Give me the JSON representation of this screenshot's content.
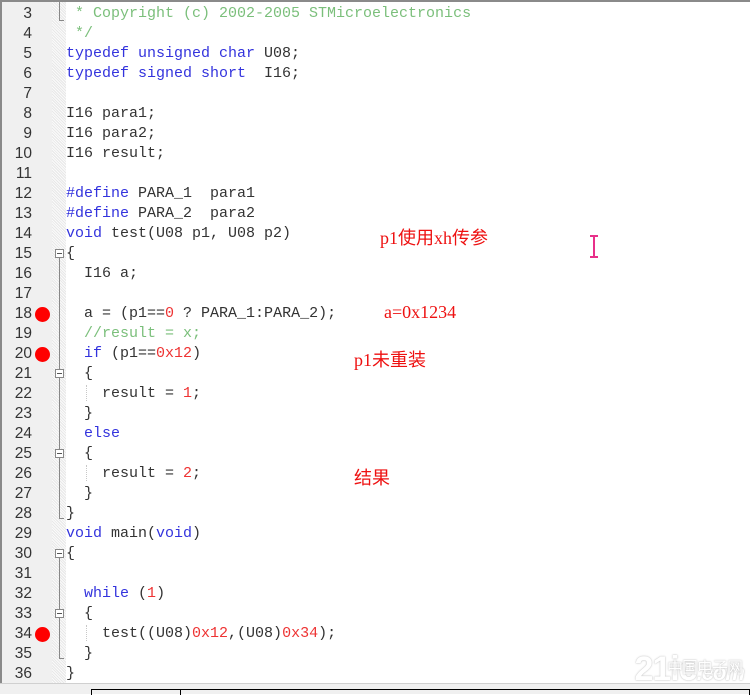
{
  "editor": {
    "lines": [
      {
        "n": "3",
        "bp": false,
        "fold": "",
        "html": [
          {
            "t": " * Copyright (c) 2002-2005 STMicroelectronics",
            "c": "cm"
          }
        ]
      },
      {
        "n": "4",
        "bp": false,
        "fold": "",
        "html": [
          {
            "t": " */",
            "c": "cm"
          }
        ]
      },
      {
        "n": "5",
        "bp": false,
        "fold": "",
        "html": [
          {
            "t": "typedef unsigned char",
            "c": "kw"
          },
          {
            "t": " U08;",
            "c": ""
          }
        ]
      },
      {
        "n": "6",
        "bp": false,
        "fold": "",
        "html": [
          {
            "t": "typedef signed short",
            "c": "kw"
          },
          {
            "t": "  I16;",
            "c": ""
          }
        ]
      },
      {
        "n": "7",
        "bp": false,
        "fold": "",
        "html": []
      },
      {
        "n": "8",
        "bp": false,
        "fold": "",
        "html": [
          {
            "t": "I16 para1;",
            "c": ""
          }
        ]
      },
      {
        "n": "9",
        "bp": false,
        "fold": "",
        "html": [
          {
            "t": "I16 para2;",
            "c": ""
          }
        ]
      },
      {
        "n": "10",
        "bp": false,
        "fold": "",
        "html": [
          {
            "t": "I16 result;",
            "c": ""
          }
        ]
      },
      {
        "n": "11",
        "bp": false,
        "fold": "",
        "html": []
      },
      {
        "n": "12",
        "bp": false,
        "fold": "",
        "html": [
          {
            "t": "#define",
            "c": "kw"
          },
          {
            "t": " PARA_1  para1",
            "c": ""
          }
        ]
      },
      {
        "n": "13",
        "bp": false,
        "fold": "",
        "html": [
          {
            "t": "#define",
            "c": "kw"
          },
          {
            "t": " PARA_2  para2",
            "c": ""
          }
        ]
      },
      {
        "n": "14",
        "bp": false,
        "fold": "",
        "html": [
          {
            "t": "void",
            "c": "kw"
          },
          {
            "t": " test(U08 p1, U08 p2)",
            "c": ""
          }
        ]
      },
      {
        "n": "15",
        "bp": false,
        "fold": "box",
        "html": [
          {
            "t": "{",
            "c": ""
          }
        ]
      },
      {
        "n": "16",
        "bp": false,
        "fold": "",
        "html": [
          {
            "t": "  I16 a;",
            "c": ""
          }
        ]
      },
      {
        "n": "17",
        "bp": false,
        "fold": "",
        "html": []
      },
      {
        "n": "18",
        "bp": true,
        "fold": "",
        "html": [
          {
            "t": "  a = (p1==",
            "c": ""
          },
          {
            "t": "0",
            "c": "nm"
          },
          {
            "t": " ? PARA_1:PARA_2);",
            "c": ""
          }
        ]
      },
      {
        "n": "19",
        "bp": false,
        "fold": "",
        "html": [
          {
            "t": "  //result = x;",
            "c": "cm"
          }
        ]
      },
      {
        "n": "20",
        "bp": true,
        "fold": "",
        "html": [
          {
            "t": "  ",
            "c": ""
          },
          {
            "t": "if",
            "c": "kw"
          },
          {
            "t": " (p1==",
            "c": ""
          },
          {
            "t": "0x12",
            "c": "nm"
          },
          {
            "t": ")",
            "c": ""
          }
        ]
      },
      {
        "n": "21",
        "bp": false,
        "fold": "box",
        "html": [
          {
            "t": "  {",
            "c": ""
          }
        ]
      },
      {
        "n": "22",
        "bp": false,
        "fold": "",
        "html": [
          {
            "t": "    result = ",
            "c": ""
          },
          {
            "t": "1",
            "c": "nm"
          },
          {
            "t": ";",
            "c": ""
          }
        ]
      },
      {
        "n": "23",
        "bp": false,
        "fold": "",
        "html": [
          {
            "t": "  }",
            "c": ""
          }
        ]
      },
      {
        "n": "24",
        "bp": false,
        "fold": "",
        "html": [
          {
            "t": "  ",
            "c": ""
          },
          {
            "t": "else",
            "c": "kw"
          }
        ]
      },
      {
        "n": "25",
        "bp": false,
        "fold": "box",
        "html": [
          {
            "t": "  {",
            "c": ""
          }
        ]
      },
      {
        "n": "26",
        "bp": false,
        "fold": "",
        "html": [
          {
            "t": "    result = ",
            "c": ""
          },
          {
            "t": "2",
            "c": "nm"
          },
          {
            "t": ";",
            "c": ""
          }
        ]
      },
      {
        "n": "27",
        "bp": false,
        "fold": "",
        "html": [
          {
            "t": "  }",
            "c": ""
          }
        ]
      },
      {
        "n": "28",
        "bp": false,
        "fold": "",
        "html": [
          {
            "t": "}",
            "c": ""
          }
        ]
      },
      {
        "n": "29",
        "bp": false,
        "fold": "",
        "html": [
          {
            "t": "void",
            "c": "kw"
          },
          {
            "t": " main(",
            "c": ""
          },
          {
            "t": "void",
            "c": "kw"
          },
          {
            "t": ")",
            "c": ""
          }
        ]
      },
      {
        "n": "30",
        "bp": false,
        "fold": "box",
        "html": [
          {
            "t": "{",
            "c": ""
          }
        ]
      },
      {
        "n": "31",
        "bp": false,
        "fold": "",
        "html": []
      },
      {
        "n": "32",
        "bp": false,
        "fold": "",
        "html": [
          {
            "t": "  ",
            "c": ""
          },
          {
            "t": "while",
            "c": "kw"
          },
          {
            "t": " (",
            "c": ""
          },
          {
            "t": "1",
            "c": "nm"
          },
          {
            "t": ")",
            "c": ""
          }
        ]
      },
      {
        "n": "33",
        "bp": false,
        "fold": "box",
        "html": [
          {
            "t": "  {",
            "c": ""
          }
        ]
      },
      {
        "n": "34",
        "bp": true,
        "fold": "",
        "html": [
          {
            "t": "    test((U08)",
            "c": ""
          },
          {
            "t": "0x12",
            "c": "nm"
          },
          {
            "t": ",(U08)",
            "c": ""
          },
          {
            "t": "0x34",
            "c": "nm"
          },
          {
            "t": ");",
            "c": ""
          }
        ]
      },
      {
        "n": "35",
        "bp": false,
        "fold": "",
        "html": [
          {
            "t": "  }",
            "c": ""
          }
        ]
      },
      {
        "n": "36",
        "bp": false,
        "fold": "",
        "html": [
          {
            "t": "}",
            "c": ""
          }
        ]
      }
    ]
  },
  "annotations": {
    "param_note": "p1使用xh传参",
    "a_value": "a=0x1234",
    "reload_note": "p1未重装",
    "result_note": "结果"
  },
  "watermark": {
    "brand": "21ic",
    "cn": "中国电子网",
    "domain": ".com"
  },
  "colors": {
    "keyword": "#3333dd",
    "comment": "#7bbf7b",
    "number": "#ee3333",
    "breakpoint": "#ff0000",
    "annotation": "#ee1111"
  }
}
